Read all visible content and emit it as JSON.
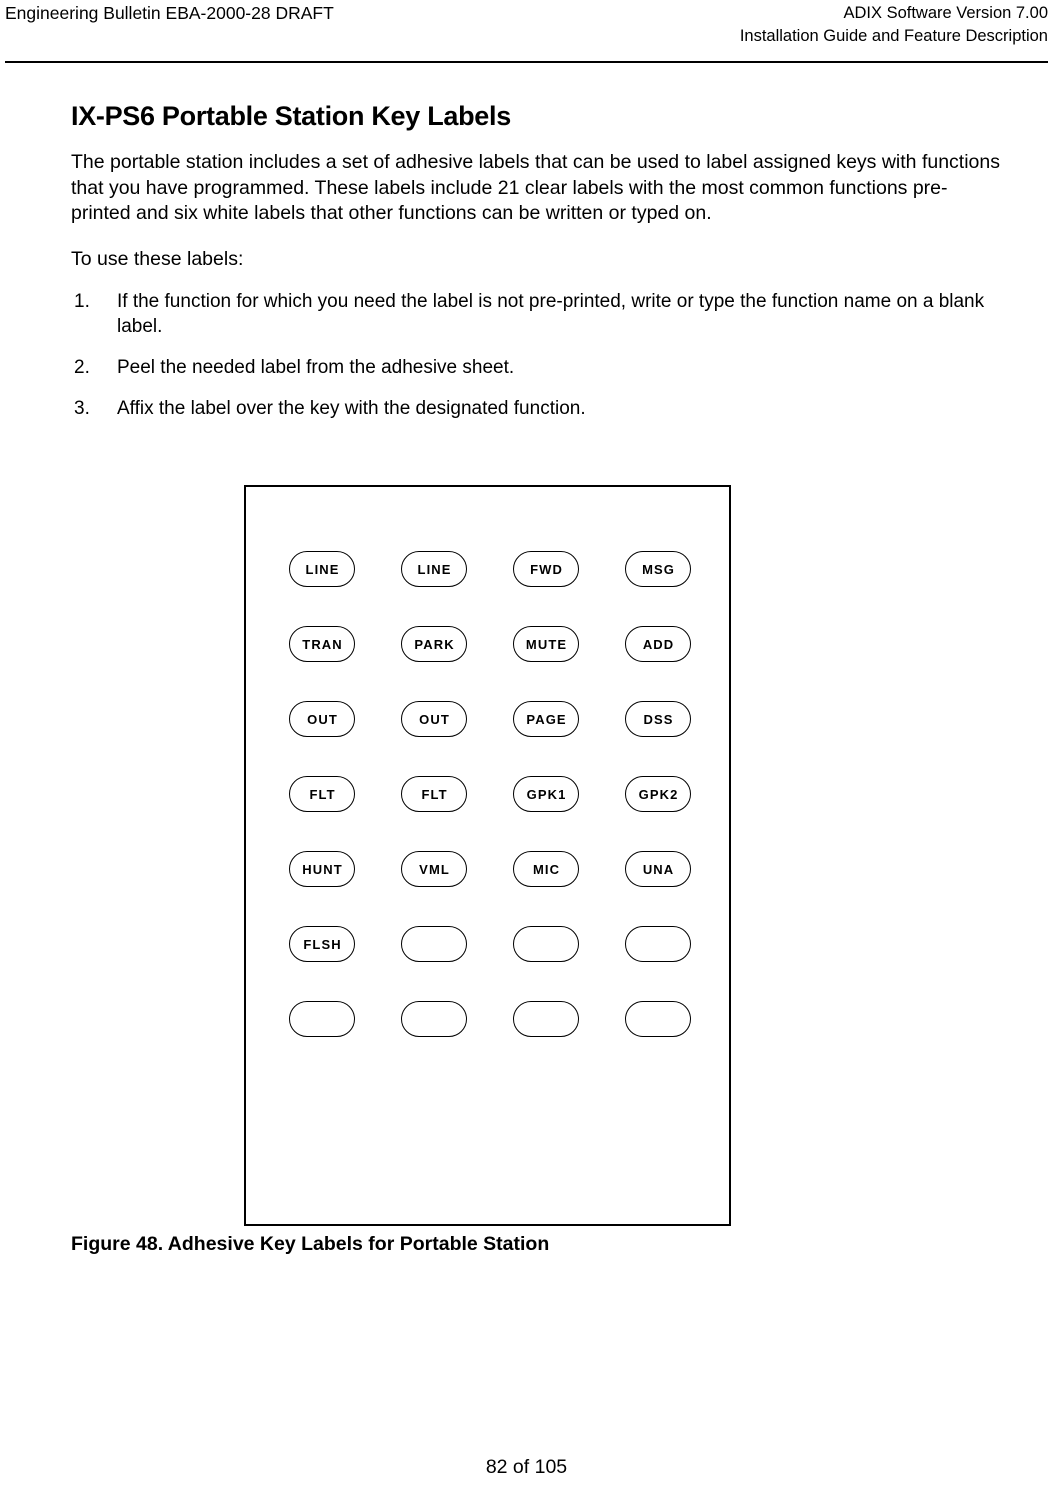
{
  "header": {
    "left_text": "Engineering Bulletin EBA-2000-28 DRAFT",
    "right_line1": "ADIX Software Version 7.00",
    "right_line2": "Installation Guide and Feature Description"
  },
  "main": {
    "section_title": "IX-PS6 Portable Station Key Labels",
    "intro_paragraph": "The portable station includes a set of adhesive labels that can be used to label assigned keys with functions that you have programmed.  These labels include 21 clear labels with the most common functions pre-printed and six white labels that other functions can be written or typed on.",
    "lead_in": "To use these labels:",
    "steps": [
      {
        "number": "1.",
        "text": "If the function for which you need the label is not pre-printed, write or type the function name on a blank label."
      },
      {
        "number": "2.",
        "text": "Peel the needed label from the adhesive sheet."
      },
      {
        "number": "3.",
        "text": "Affix the label over the key with the designated function."
      }
    ]
  },
  "figure": {
    "caption": "Figure 48.  Adhesive Key Labels for Portable Station",
    "key_label_rows": [
      [
        "LINE",
        "LINE",
        "FWD",
        "MSG"
      ],
      [
        "TRAN",
        "PARK",
        "MUTE",
        "ADD"
      ],
      [
        "OUT",
        "OUT",
        "PAGE",
        "DSS"
      ],
      [
        "FLT",
        "FLT",
        "GPK1",
        "GPK2"
      ],
      [
        "HUNT",
        "VML",
        "MIC",
        "UNA"
      ],
      [
        "FLSH",
        "",
        "",
        ""
      ],
      [
        "",
        "",
        "",
        ""
      ]
    ]
  },
  "footer": {
    "page_text": "82 of 105"
  },
  "colors": {
    "text": "#000000",
    "rule": "#000000",
    "page_background": "#ffffff",
    "pill_border": "#000000"
  }
}
